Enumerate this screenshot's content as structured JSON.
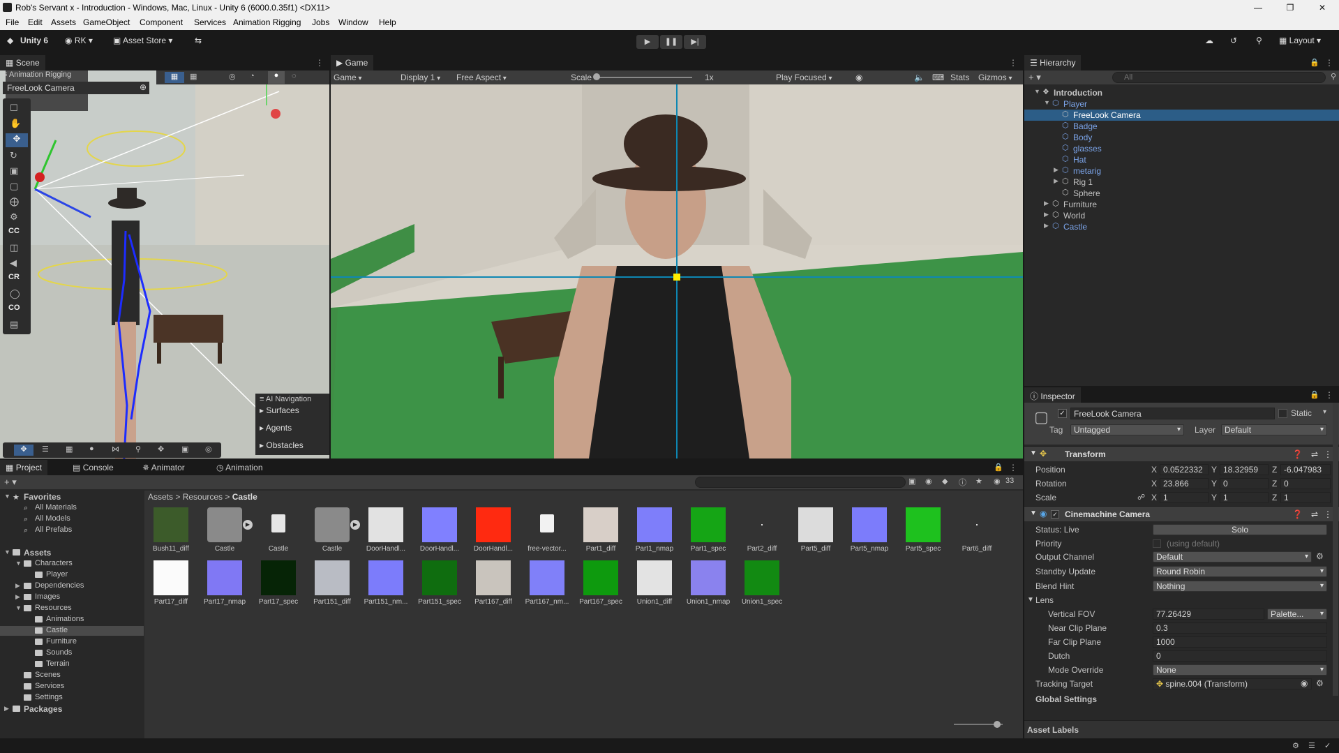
{
  "window": {
    "title": "Rob's Servant x - Introduction - Windows, Mac, Linux - Unity 6 (6000.0.35f1) <DX11>"
  },
  "menu": [
    "File",
    "Edit",
    "Assets",
    "GameObject",
    "Component",
    "Services",
    "Animation Rigging",
    "Jobs",
    "Window",
    "Help"
  ],
  "toolbar": {
    "unity": "Unity 6",
    "account": "RK",
    "asset_store": "Asset Store",
    "layout": "Layout"
  },
  "scene": {
    "tab": "Scene",
    "overlay_title": "Animation Rigging",
    "camera_label": "FreeLook Camera",
    "tool_labels": [
      "CC",
      "CR",
      "CO"
    ],
    "ai_nav": {
      "title": "AI Navigation",
      "items": [
        "Surfaces",
        "Agents",
        "Obstacles"
      ]
    }
  },
  "game": {
    "tab": "Game",
    "mode": "Game",
    "display": "Display 1",
    "aspect": "Free Aspect",
    "scale_label": "Scale",
    "scale_value": "1x",
    "play_focus": "Play Focused",
    "stats": "Stats",
    "gizmos": "Gizmos"
  },
  "hierarchy": {
    "tab": "Hierarchy",
    "search_placeholder": "All",
    "rows": [
      {
        "label": "Introduction",
        "depth": 0,
        "bold": true,
        "arrow": "▼"
      },
      {
        "label": "Player",
        "depth": 1,
        "blue": true,
        "arrow": "▼"
      },
      {
        "label": "FreeLook Camera",
        "depth": 2,
        "selected": true,
        "arrow": ""
      },
      {
        "label": "Badge",
        "depth": 2,
        "blue": true,
        "arrow": ""
      },
      {
        "label": "Body",
        "depth": 2,
        "blue": true,
        "arrow": ""
      },
      {
        "label": "glasses",
        "depth": 2,
        "blue": true,
        "arrow": ""
      },
      {
        "label": "Hat",
        "depth": 2,
        "blue": true,
        "arrow": ""
      },
      {
        "label": "metarig",
        "depth": 2,
        "blue": true,
        "arrow": "▶"
      },
      {
        "label": "Rig 1",
        "depth": 2,
        "arrow": "▶"
      },
      {
        "label": "Sphere",
        "depth": 2,
        "arrow": ""
      },
      {
        "label": "Furniture",
        "depth": 1,
        "arrow": "▶"
      },
      {
        "label": "World",
        "depth": 1,
        "arrow": "▶"
      },
      {
        "label": "Castle",
        "depth": 1,
        "blue": true,
        "arrow": "▶"
      }
    ]
  },
  "inspector": {
    "tab": "Inspector",
    "object_name": "FreeLook Camera",
    "static_label": "Static",
    "tag_label": "Tag",
    "tag_value": "Untagged",
    "layer_label": "Layer",
    "layer_value": "Default",
    "transform": {
      "title": "Transform",
      "position": {
        "label": "Position",
        "x": "0.0522332",
        "y": "18.32959",
        "z": "-6.047983"
      },
      "rotation": {
        "label": "Rotation",
        "x": "23.866",
        "y": "0",
        "z": "0"
      },
      "scale": {
        "label": "Scale",
        "x": "1",
        "y": "1",
        "z": "1"
      }
    },
    "cinemachine": {
      "title": "Cinemachine Camera",
      "status_label": "Status: Live",
      "solo": "Solo",
      "priority_label": "Priority",
      "priority_value": "(using default)",
      "output_label": "Output Channel",
      "output_value": "Default",
      "standby_label": "Standby Update",
      "standby_value": "Round Robin",
      "blend_label": "Blend Hint",
      "blend_value": "Nothing",
      "lens_label": "Lens",
      "vfov_label": "Vertical FOV",
      "vfov_value": "77.26429",
      "palette": "Palette...",
      "near_label": "Near Clip Plane",
      "near_value": "0.3",
      "far_label": "Far Clip Plane",
      "far_value": "1000",
      "dutch_label": "Dutch",
      "dutch_value": "0",
      "mode_label": "Mode Override",
      "mode_value": "None",
      "tracking_label": "Tracking Target",
      "tracking_value": "spine.004 (Transform)",
      "global_label": "Global Settings"
    },
    "asset_labels": "Asset Labels"
  },
  "project": {
    "tabs": [
      "Project",
      "Console",
      "Animator",
      "Animation"
    ],
    "breadcrumb": [
      "Assets",
      "Resources",
      "Castle"
    ],
    "count": "33",
    "tree": [
      {
        "label": "Favorites",
        "depth": 0,
        "bold": true,
        "arrow": "▼",
        "kind": "star"
      },
      {
        "label": "All Materials",
        "depth": 1,
        "kind": "search"
      },
      {
        "label": "All Models",
        "depth": 1,
        "kind": "search"
      },
      {
        "label": "All Prefabs",
        "depth": 1,
        "kind": "search"
      },
      {
        "label": "",
        "depth": 0,
        "kind": "spacer"
      },
      {
        "label": "Assets",
        "depth": 0,
        "bold": true,
        "arrow": "▼",
        "kind": "folder"
      },
      {
        "label": "Characters",
        "depth": 1,
        "arrow": "▼",
        "kind": "folder"
      },
      {
        "label": "Player",
        "depth": 2,
        "kind": "folder"
      },
      {
        "label": "Dependencies",
        "depth": 1,
        "arrow": "▶",
        "kind": "folder"
      },
      {
        "label": "Images",
        "depth": 1,
        "arrow": "▶",
        "kind": "folder"
      },
      {
        "label": "Resources",
        "depth": 1,
        "arrow": "▼",
        "kind": "folder"
      },
      {
        "label": "Animations",
        "depth": 2,
        "kind": "folder"
      },
      {
        "label": "Castle",
        "depth": 2,
        "kind": "folder",
        "selected": true
      },
      {
        "label": "Furniture",
        "depth": 2,
        "kind": "folder"
      },
      {
        "label": "Sounds",
        "depth": 2,
        "kind": "folder"
      },
      {
        "label": "Terrain",
        "depth": 2,
        "kind": "folder"
      },
      {
        "label": "Scenes",
        "depth": 1,
        "kind": "folder"
      },
      {
        "label": "Services",
        "depth": 1,
        "kind": "folder"
      },
      {
        "label": "Settings",
        "depth": 1,
        "kind": "folder"
      },
      {
        "label": "Packages",
        "depth": 0,
        "bold": true,
        "arrow": "▶",
        "kind": "folder"
      }
    ],
    "assets_row1": [
      {
        "name": "Bush11_diff",
        "color": "#3c5b2a"
      },
      {
        "name": "Castle",
        "color": "#8a8a8a",
        "prefab": true
      },
      {
        "name": "Castle",
        "color": "#e6e6e6",
        "file": "MTL"
      },
      {
        "name": "Castle",
        "color": "#8a8a8a",
        "prefab": true
      },
      {
        "name": "DoorHandl...",
        "color": "#e2e2e2"
      },
      {
        "name": "DoorHandl...",
        "color": "#8080ff"
      },
      {
        "name": "DoorHandl...",
        "color": "#ff2a10"
      },
      {
        "name": "free-vector...",
        "color": "#f2f2f2",
        "file": "IMG"
      },
      {
        "name": "Part1_diff",
        "color": "#d8cfc8"
      },
      {
        "name": "Part1_nmap",
        "color": "#7e7efa"
      },
      {
        "name": "Part1_spec",
        "color": "#15a515"
      },
      {
        "name": "Part2_diff",
        "color": "dot"
      },
      {
        "name": "Part5_diff",
        "color": "#dcdcdc"
      },
      {
        "name": "Part5_nmap",
        "color": "#7c7cfb"
      },
      {
        "name": "Part5_spec",
        "color": "#1ec11e"
      },
      {
        "name": "Part6_diff",
        "color": "dot"
      }
    ],
    "assets_row2": [
      {
        "name": "Part17_diff",
        "color": "#fbfbfb"
      },
      {
        "name": "Part17_nmap",
        "color": "#8078f4"
      },
      {
        "name": "Part17_spec",
        "color": "#062406"
      },
      {
        "name": "Part151_diff",
        "color": "#b9bcc4"
      },
      {
        "name": "Part151_nm...",
        "color": "#7c7cfb"
      },
      {
        "name": "Part151_spec",
        "color": "#0f6d0f"
      },
      {
        "name": "Part167_diff",
        "color": "#c9c4bd"
      },
      {
        "name": "Part167_nm...",
        "color": "#8080f9"
      },
      {
        "name": "Part167_spec",
        "color": "#0e9a0e"
      },
      {
        "name": "Union1_diff",
        "color": "#e3e3e3"
      },
      {
        "name": "Union1_nmap",
        "color": "#8a82ee"
      },
      {
        "name": "Union1_spec",
        "color": "#128a12"
      }
    ]
  }
}
